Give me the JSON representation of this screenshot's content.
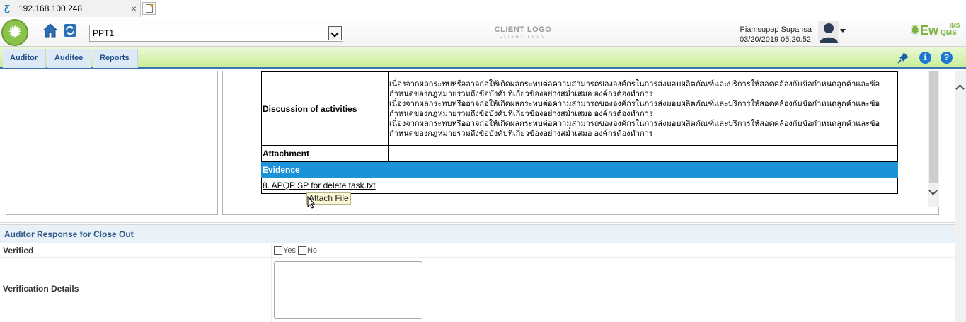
{
  "browser": {
    "tab_title": "192.168.100.248",
    "tab_close": "×"
  },
  "header": {
    "org_select_value": "PPT1",
    "client_logo": "CLIENT LOGO",
    "client_logo_sub": "CLIENT LOGO",
    "user_name": "Piamsupap Supansa",
    "datetime": "03/20/2019 05:20:52",
    "brand": {
      "ew": "Ew",
      "ims": "IMS",
      "qms": "QMS"
    }
  },
  "menu": {
    "items": [
      {
        "label": "Auditor"
      },
      {
        "label": "Auditee"
      },
      {
        "label": "Reports"
      }
    ]
  },
  "details": {
    "discussion_label": "Discussion of activities",
    "discussion_lines": [
      "เนื่องจากผลกระทบหรืออาจก่อให้เกิดผลกระทบต่อความสามารถขององค์กรในการส่งมอบผลิตภัณฑ์และบริการให้สอดคล้องกับข้อกำหนดลูกค้าและข้อ",
      "กำหนดของกฎหมายรวมถึงข้อบังคับที่เกี่ยวข้องอย่างสม่ำเสมอ องค์กรต้องทำการ",
      "เนื่องจากผลกระทบหรืออาจก่อให้เกิดผลกระทบต่อความสามารถขององค์กรในการส่งมอบผลิตภัณฑ์และบริการให้สอดคล้องกับข้อกำหนดลูกค้าและข้อ",
      "กำหนดของกฎหมายรวมถึงข้อบังคับที่เกี่ยวข้องอย่างสม่ำเสมอ องค์กรต้องทำการ",
      "เนื่องจากผลกระทบหรืออาจก่อให้เกิดผลกระทบต่อความสามารถขององค์กรในการส่งมอบผลิตภัณฑ์และบริการให้สอดคล้องกับข้อกำหนดลูกค้าและข้อ",
      "กำหนดของกฎหมายรวมถึงข้อบังคับที่เกี่ยวข้องอย่างสม่ำเสมอ องค์กรต้องทำการ"
    ],
    "attachment_label": "Attachment",
    "evidence_header": "Evidence",
    "evidence_file": "8. APQP SP for delete task.txt",
    "tooltip": "Attach File"
  },
  "close_out": {
    "section_title": "Auditor Response for Close Out",
    "verified_label": "Verified",
    "option_yes": "Yes",
    "option_no": "No",
    "verification_details_label": "Verification Details",
    "verification_details_value": ""
  },
  "colors": {
    "evidence_bg": "#1c93d8",
    "menubar_green": "#c8ee96",
    "menu_text": "#1f4d86",
    "accent_blue": "#3b75b4"
  },
  "icons": {
    "app_logo": "sun-logo-icon",
    "home": "home-icon",
    "refresh": "refresh-icon",
    "avatar": "user-avatar-icon",
    "pin": "pin-icon",
    "info": "info-icon",
    "help": "help-icon",
    "cursor": "mouse-cursor-icon"
  }
}
